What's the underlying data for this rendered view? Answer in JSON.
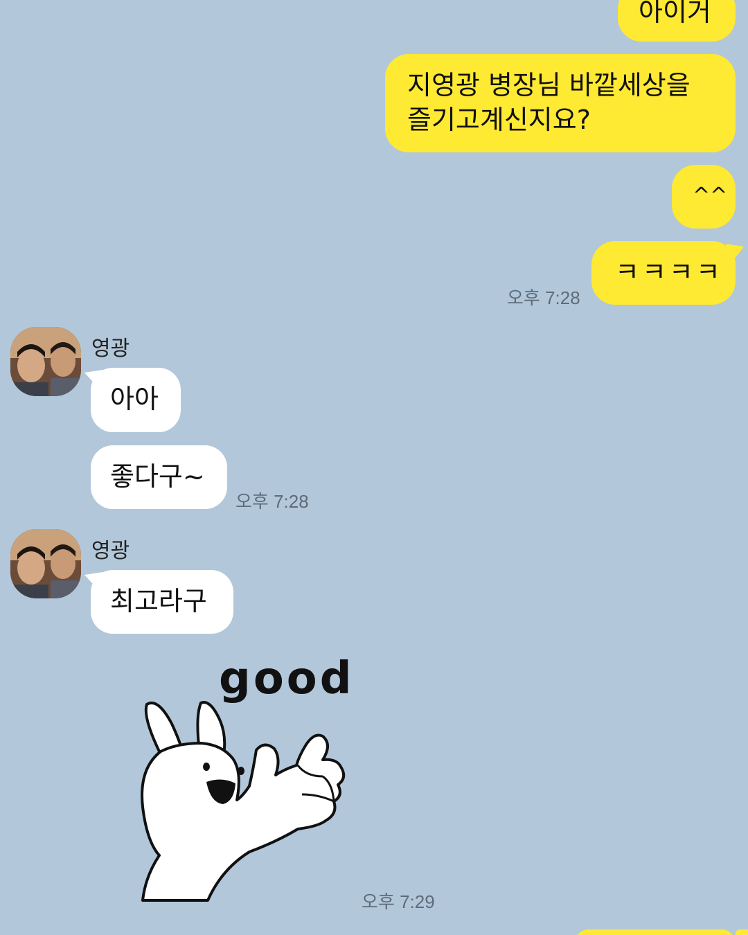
{
  "messages_me": [
    {
      "text": "아이거"
    },
    {
      "text": "지영광 병장님 바깥세상을\n즐기고계신지요?"
    },
    {
      "text": "^^"
    },
    {
      "text": "ㅋㅋㅋㅋ"
    }
  ],
  "time_me_1": "오후 7:28",
  "group1": {
    "sender": "영광",
    "messages": [
      "아아",
      "좋다구~"
    ],
    "time": "오후 7:28"
  },
  "group2": {
    "sender": "영광",
    "messages": [
      "최고라구"
    ],
    "sticker_text": "good",
    "time": "오후 7:29"
  },
  "colors": {
    "background": "#b2c7da",
    "my_bubble": "#fee933",
    "their_bubble": "#ffffff"
  },
  "icons": {
    "avatar": "profile-photo",
    "sticker": "rabbit-thumbs-up"
  }
}
